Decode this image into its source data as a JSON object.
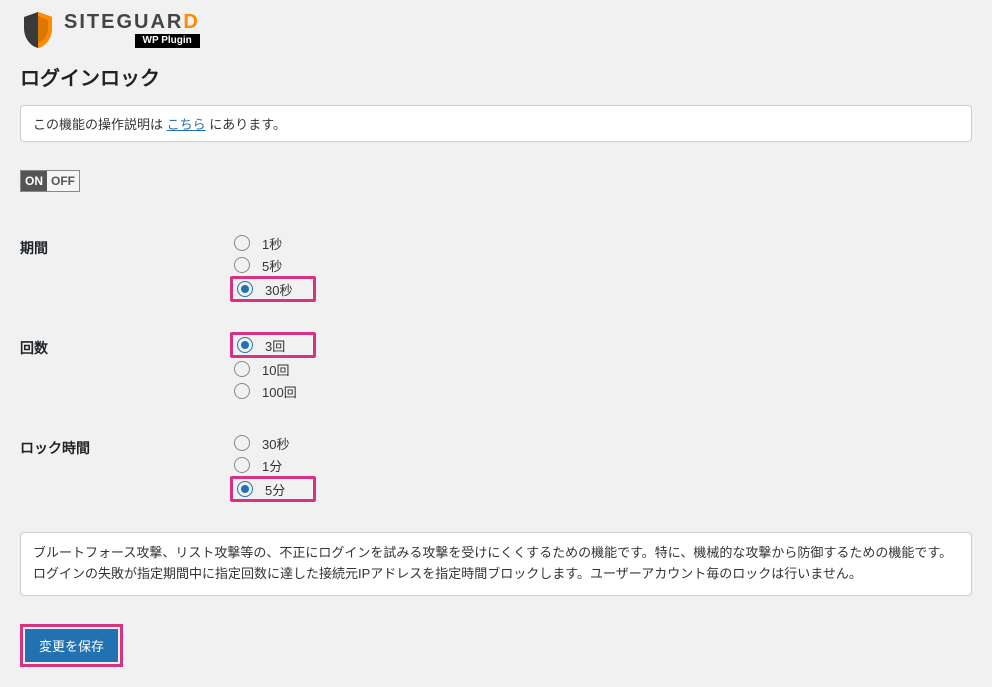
{
  "brand": {
    "name_part1": "SITE",
    "name_part2": "GUAR",
    "name_part3": "D",
    "tagline": "WP Plugin"
  },
  "page_title": "ログインロック",
  "notice": {
    "prefix": "この機能の操作説明は ",
    "link": "こちら",
    "suffix": " にあります。"
  },
  "toggle": {
    "on_label": "ON",
    "off_label": "OFF",
    "state": "on"
  },
  "form": {
    "groups": [
      {
        "label": "期間",
        "options": [
          {
            "label": "1秒",
            "checked": false,
            "highlight": false
          },
          {
            "label": "5秒",
            "checked": false,
            "highlight": false
          },
          {
            "label": "30秒",
            "checked": true,
            "highlight": true
          }
        ]
      },
      {
        "label": "回数",
        "options": [
          {
            "label": "3回",
            "checked": true,
            "highlight": true
          },
          {
            "label": "10回",
            "checked": false,
            "highlight": false
          },
          {
            "label": "100回",
            "checked": false,
            "highlight": false
          }
        ]
      },
      {
        "label": "ロック時間",
        "options": [
          {
            "label": "30秒",
            "checked": false,
            "highlight": false
          },
          {
            "label": "1分",
            "checked": false,
            "highlight": false
          },
          {
            "label": "5分",
            "checked": true,
            "highlight": true
          }
        ]
      }
    ]
  },
  "description": "ブルートフォース攻撃、リスト攻撃等の、不正にログインを試みる攻撃を受けにくくするための機能です。特に、機械的な攻撃から防御するための機能です。ログインの失敗が指定期間中に指定回数に達した接続元IPアドレスを指定時間ブロックします。ユーザーアカウント毎のロックは行いません。",
  "save_button": "変更を保存"
}
